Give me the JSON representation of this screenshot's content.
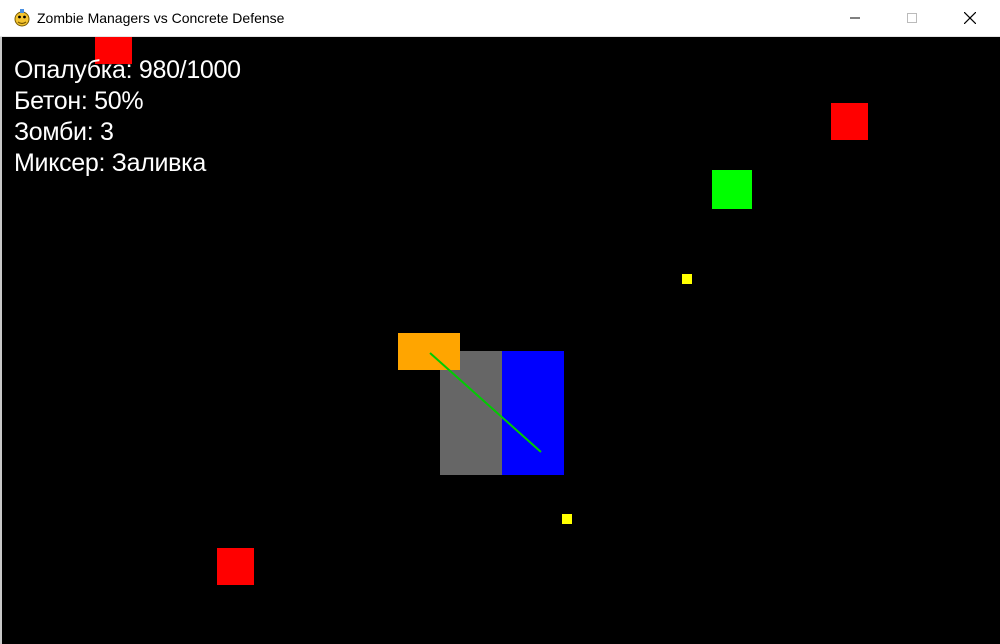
{
  "window": {
    "title": "Zombie Managers vs Concrete Defense",
    "icon": "pygame-snake-icon",
    "controls": [
      "minimize-icon",
      "maximize-icon",
      "close-icon"
    ]
  },
  "hud": {
    "formwork": "Опалубка: 980/1000",
    "concrete": "Бетон: 50%",
    "zombies": "Зомби: 3",
    "mixer": "Миксер: Заливка"
  },
  "colors": {
    "background": "#000000",
    "zombie": "#ff0000",
    "ally": "#00ff00",
    "resource": "#ffff00",
    "mixer": "#ffa500",
    "wall_gray": "#666666",
    "wall_blue": "#0000ff",
    "beam": "#00cc00"
  }
}
